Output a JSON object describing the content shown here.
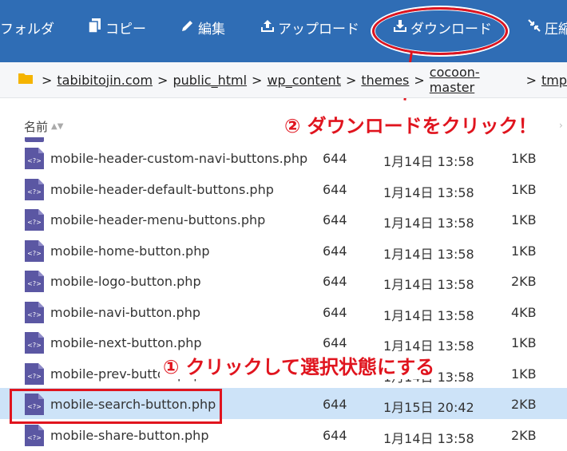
{
  "toolbar": {
    "folder_label": "フォルダ",
    "copy_label": "コピー",
    "edit_label": "編集",
    "upload_label": "アップロード",
    "download_label": "ダウンロード",
    "compress_label": "圧縮",
    "background": "#2f6db5"
  },
  "breadcrumb": {
    "items": [
      "tabibitojin.com",
      "public_html",
      "wp_content",
      "themes",
      "cocoon-master",
      "tmp"
    ],
    "separator": ">"
  },
  "annotations": {
    "download_note": "② ダウンロードをクリック！",
    "select_note": "① クリックして選択状態にする",
    "accent": "#e0141e"
  },
  "columns": {
    "name": "名前"
  },
  "files": [
    {
      "name": "mobile-header-custom-navi-buttons.php",
      "perm": "644",
      "date": "1月14日 13:58",
      "size": "1KB"
    },
    {
      "name": "mobile-header-default-buttons.php",
      "perm": "644",
      "date": "1月14日 13:58",
      "size": "1KB"
    },
    {
      "name": "mobile-header-menu-buttons.php",
      "perm": "644",
      "date": "1月14日 13:58",
      "size": "1KB"
    },
    {
      "name": "mobile-home-button.php",
      "perm": "644",
      "date": "1月14日 13:58",
      "size": "1KB"
    },
    {
      "name": "mobile-logo-button.php",
      "perm": "644",
      "date": "1月14日 13:58",
      "size": "2KB"
    },
    {
      "name": "mobile-navi-button.php",
      "perm": "644",
      "date": "1月14日 13:58",
      "size": "4KB"
    },
    {
      "name": "mobile-next-button.php",
      "perm": "644",
      "date": "1月14日 13:58",
      "size": "1KB"
    },
    {
      "name": "mobile-prev-button.php",
      "perm": "644",
      "date": "1月14日 13:58",
      "size": "1KB"
    },
    {
      "name": "mobile-search-button.php",
      "perm": "644",
      "date": "1月15日 20:42",
      "size": "2KB"
    },
    {
      "name": "mobile-share-button.php",
      "perm": "644",
      "date": "1月14日 13:58",
      "size": "2KB"
    }
  ],
  "selected_index": 8,
  "selected_color": "#cde3f8",
  "file_icon_color": "#5b57a3"
}
